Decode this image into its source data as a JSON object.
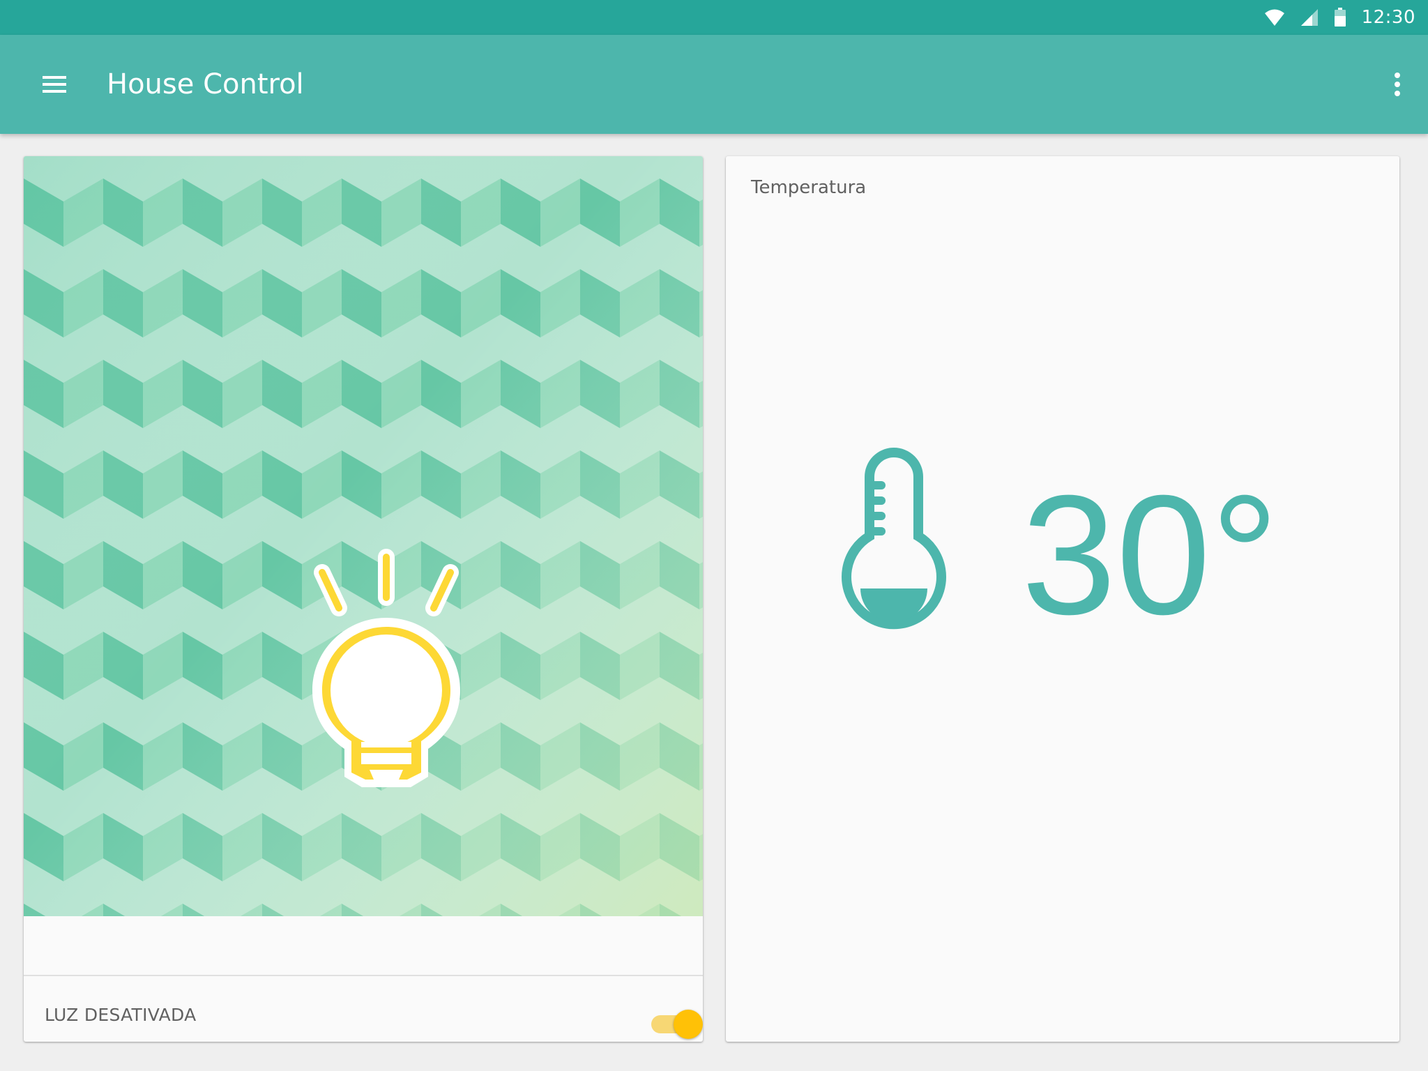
{
  "status_bar": {
    "time": "12:30",
    "icons": [
      "wifi-icon",
      "signal-icon",
      "battery-icon"
    ]
  },
  "app_bar": {
    "title": "House Control",
    "icons": [
      "menu-icon",
      "more-vert-icon"
    ]
  },
  "light_card": {
    "label": "LUZ DESATIVADA",
    "switch_on": true,
    "icon": "lightbulb-icon"
  },
  "temperature_card": {
    "label": "Temperatura",
    "value": "30°",
    "icon": "thermometer-icon"
  },
  "colors": {
    "status_bar": "#26a69a",
    "app_bar": "#4db6ac",
    "accent_teal": "#4db6ac",
    "bulb_yellow": "#fdd835",
    "switch_thumb": "#ffc107",
    "switch_track": "#f7d774",
    "pattern_light": "#b2e3cf",
    "pattern_mid": "#8fd8b9",
    "pattern_dark": "#66c7a5"
  }
}
